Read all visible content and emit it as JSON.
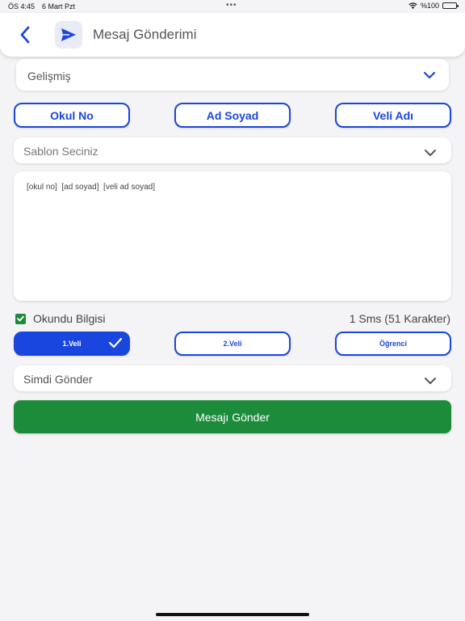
{
  "status": {
    "time": "ÖS 4:45",
    "date": "6 Mart Pzt",
    "dots": "•••",
    "battery": "%100",
    "battery_level": 1.0
  },
  "header": {
    "title": "Mesaj Gönderimi",
    "back_icon": "chevron-left-icon",
    "send_icon": "send-icon"
  },
  "advanced": {
    "label": "Gelişmiş"
  },
  "tags": [
    {
      "label": "Okul No"
    },
    {
      "label": "Ad Soyad"
    },
    {
      "label": "Veli Adı"
    }
  ],
  "template": {
    "placeholder": "Sablon Seciniz"
  },
  "message": {
    "text": "[okul no]  [ad soyad]  [veli ad soyad]"
  },
  "read_receipt": {
    "label": "Okundu Bilgisi",
    "checked": true
  },
  "sms_count": "1 Sms (51 Karakter)",
  "recipients": [
    {
      "label": "1.Veli",
      "selected": true
    },
    {
      "label": "2.Veli",
      "selected": false
    },
    {
      "label": "Öğrenci",
      "selected": false
    }
  ],
  "schedule": {
    "value": "Simdi Gönder"
  },
  "send_button": {
    "label": "Mesajı Gönder"
  },
  "colors": {
    "accent": "#1a46e0",
    "success": "#1c8c3a",
    "background": "#f4f4f6"
  }
}
